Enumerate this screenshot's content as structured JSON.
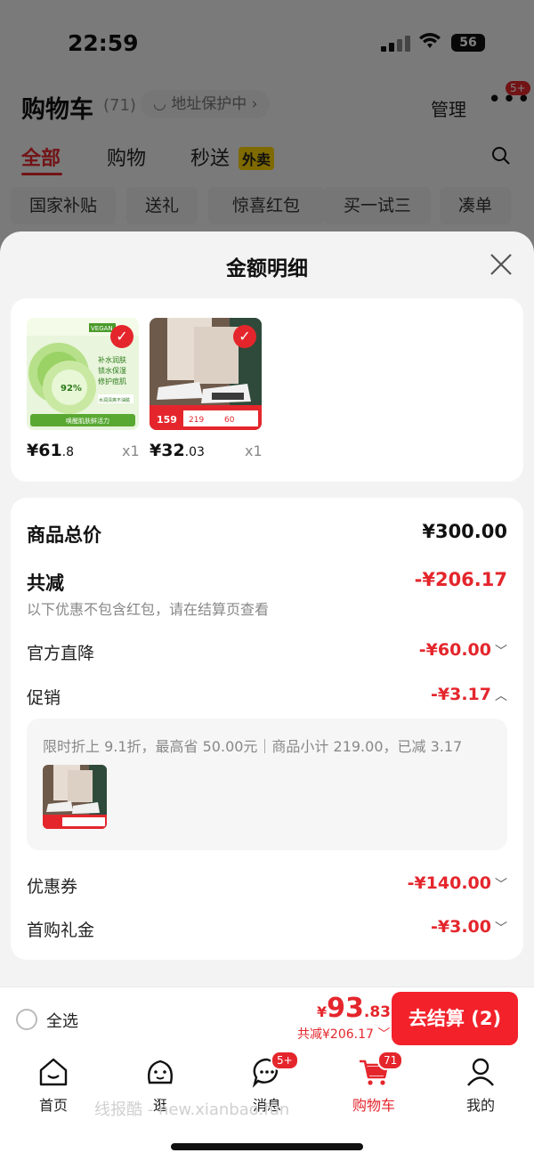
{
  "status_bar": {
    "time": "22:59",
    "battery": "56"
  },
  "cart": {
    "title": "购物车",
    "count": "(71)",
    "address_pill": "地址保护中 ›",
    "manage": "管理",
    "more_badge": "5+"
  },
  "tabs": [
    {
      "label": "全部",
      "active": true
    },
    {
      "label": "购物"
    },
    {
      "label": "秒送"
    }
  ],
  "waimai_tag": "外卖",
  "chips": [
    "国家补贴",
    "送礼",
    "惊喜红包",
    "买一试三",
    "凑单"
  ],
  "sheet": {
    "title": "金额明细",
    "products": [
      {
        "price_int": "¥61",
        "price_dec": ".8",
        "qty": "x1"
      },
      {
        "price_int": "¥32",
        "price_dec": ".03",
        "qty": "x1"
      }
    ],
    "product_thumb_text": {
      "p1": [
        "补水润肤",
        "锁水保湿",
        "修护痘肌",
        "水润清爽不油腻",
        "唤醒肌肤鲜活力",
        "VEGAN",
        "92%"
      ],
      "p2": [
        "159",
        "219",
        "60"
      ]
    },
    "details": {
      "total_label": "商品总价",
      "total_value": "¥300.00",
      "reduce_label": "共减",
      "reduce_value": "-¥206.17",
      "note": "以下优惠不包含红包，请在结算页查看",
      "direct_label": "官方直降",
      "direct_value": "-¥60.00",
      "promo_label": "促销",
      "promo_value": "-¥3.17",
      "promo_desc": "限时折上 9.1折，最高省 50.00元｜商品小计 219.00，已减 3.17",
      "coupon_label": "优惠券",
      "coupon_value": "-¥140.00",
      "first_label": "首购礼金",
      "first_value": "-¥3.00"
    }
  },
  "checkout": {
    "select_all": "全选",
    "currency": "¥",
    "total_int": "93",
    "total_dec": ".83",
    "saved": "共减¥206.17",
    "pay_button": "去结算 (2)"
  },
  "tabbar": [
    {
      "label": "首页",
      "icon": "home-icon"
    },
    {
      "label": "逛",
      "icon": "face-icon"
    },
    {
      "label": "消息",
      "icon": "message-icon",
      "badge": "5+"
    },
    {
      "label": "购物车",
      "icon": "cart-icon",
      "badge": "71",
      "active": true
    },
    {
      "label": "我的",
      "icon": "profile-icon"
    }
  ],
  "watermark": "线报酷 - new.xianbao.fun",
  "colors": {
    "accent": "#e4262c",
    "button": "#f3212a"
  }
}
